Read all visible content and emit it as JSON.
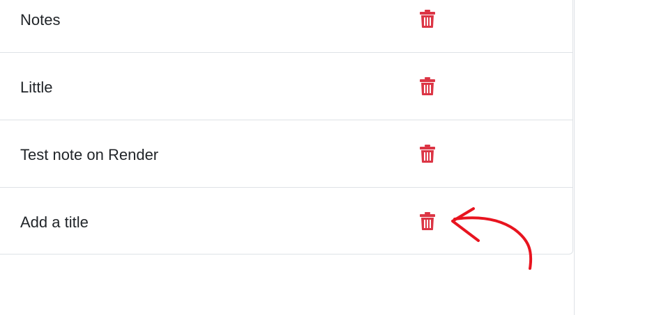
{
  "notes": [
    {
      "title": "Notes"
    },
    {
      "title": "Little"
    },
    {
      "title": "Test note on Render"
    },
    {
      "title": "Add a title"
    }
  ],
  "icons": {
    "delete": "trash-icon",
    "annotation": "red-arrow-annotation"
  },
  "colors": {
    "delete_icon": "#dc3545",
    "annotation": "#e8141f",
    "divider": "#dee2e6",
    "text": "#212529"
  }
}
